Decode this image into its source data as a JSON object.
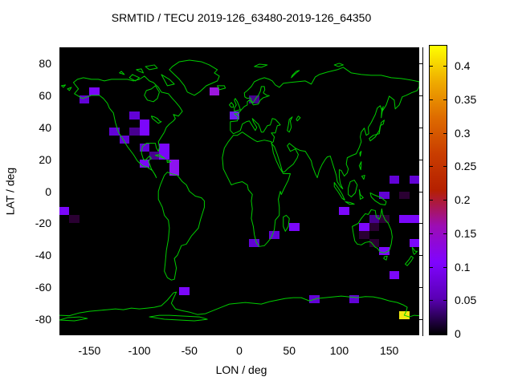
{
  "figure": {
    "title": "SRMTID / TECU 2019-126_63480-2019-126_64350",
    "x_axis": {
      "label": "LON / deg",
      "range": [
        -180,
        180
      ],
      "ticks": [
        -150,
        -100,
        -50,
        0,
        50,
        100,
        150
      ]
    },
    "y_axis": {
      "label": "LAT / deg",
      "range": [
        -90,
        90
      ],
      "ticks": [
        80,
        60,
        40,
        20,
        0,
        -20,
        -40,
        -60,
        -80
      ]
    },
    "map": {
      "background": "#000000",
      "coastline_color": "#00cc00"
    },
    "colorbar": {
      "min": 0,
      "max": 0.43,
      "ticks": [
        {
          "value": 0,
          "label": "0"
        },
        {
          "value": 0.05,
          "label": "0.05"
        },
        {
          "value": 0.1,
          "label": "0.1"
        },
        {
          "value": 0.15,
          "label": "0.15"
        },
        {
          "value": 0.2,
          "label": "0.2"
        },
        {
          "value": 0.25,
          "label": "0.25"
        },
        {
          "value": 0.3,
          "label": "0.3"
        },
        {
          "value": 0.35,
          "label": "0.35"
        },
        {
          "value": 0.4,
          "label": "0.4"
        }
      ],
      "gradient": [
        {
          "pos": 0.0,
          "color": "#000000"
        },
        {
          "pos": 0.125,
          "color": "#5a00b5"
        },
        {
          "pos": 0.25,
          "color": "#8004ff"
        },
        {
          "pos": 0.375,
          "color": "#9c0db5"
        },
        {
          "pos": 0.5,
          "color": "#b52000"
        },
        {
          "pos": 0.625,
          "color": "#c93d00"
        },
        {
          "pos": 0.75,
          "color": "#de6b00"
        },
        {
          "pos": 0.875,
          "color": "#efab00"
        },
        {
          "pos": 1.0,
          "color": "#ffff00"
        }
      ]
    }
  },
  "chart_data": {
    "type": "heatmap",
    "title": "SRMTID / TECU 2019-126_63480-2019-126_64350",
    "xlabel": "LON / deg",
    "ylabel": "LAT / deg",
    "xlim": [
      -180,
      180
    ],
    "ylim": [
      -90,
      90
    ],
    "colorbar_range": [
      0,
      0.43
    ],
    "cell_size": {
      "lon_deg": 10,
      "lat_deg": 5
    },
    "cells": [
      {
        "lon": -150,
        "lat": 60,
        "value": 0.1,
        "color": "#7b07fa"
      },
      {
        "lon": -160,
        "lat": 55,
        "value": 0.07,
        "color": "#6202d6"
      },
      {
        "lon": -30,
        "lat": 60,
        "value": 0.14,
        "color": "#9b17dd"
      },
      {
        "lon": -110,
        "lat": 45,
        "value": 0.07,
        "color": "#6202d6"
      },
      {
        "lon": -100,
        "lat": 40,
        "value": 0.1,
        "color": "#7b07fa"
      },
      {
        "lon": -130,
        "lat": 35,
        "value": 0.07,
        "color": "#6202d6"
      },
      {
        "lon": -110,
        "lat": 35,
        "value": 0.04,
        "color": "#47008f"
      },
      {
        "lon": -100,
        "lat": 35,
        "value": 0.1,
        "color": "#7b07fa"
      },
      {
        "lon": -120,
        "lat": 30,
        "value": 0.07,
        "color": "#6202d6"
      },
      {
        "lon": -100,
        "lat": 25,
        "value": 0.07,
        "color": "#6202d6"
      },
      {
        "lon": -80,
        "lat": 25,
        "value": 0.1,
        "color": "#7b07fa"
      },
      {
        "lon": -90,
        "lat": 20,
        "value": 0.04,
        "color": "#47008f"
      },
      {
        "lon": -80,
        "lat": 20,
        "value": 0.1,
        "color": "#7b07fa"
      },
      {
        "lon": -100,
        "lat": 15,
        "value": 0.1,
        "color": "#7b07fa"
      },
      {
        "lon": -70,
        "lat": 15,
        "value": 0.12,
        "color": "#8d13ef"
      },
      {
        "lon": -70,
        "lat": 10,
        "value": 0.12,
        "color": "#8d13ef"
      },
      {
        "lon": 10,
        "lat": 55,
        "value": 0.04,
        "color": "#47008f"
      },
      {
        "lon": -10,
        "lat": 45,
        "value": 0.1,
        "color": "#6d1df2"
      },
      {
        "lon": 150,
        "lat": 5,
        "value": 0.07,
        "color": "#6202d6"
      },
      {
        "lon": 170,
        "lat": 5,
        "value": 0.07,
        "color": "#6202d6"
      },
      {
        "lon": 140,
        "lat": -5,
        "value": 0.07,
        "color": "#6202d6"
      },
      {
        "lon": 160,
        "lat": -5,
        "value": 0.015,
        "color": "#2a0032"
      },
      {
        "lon": -180,
        "lat": -15,
        "value": 0.1,
        "color": "#7b07fa"
      },
      {
        "lon": -170,
        "lat": -20,
        "value": 0.015,
        "color": "#2a0032"
      },
      {
        "lon": 100,
        "lat": -15,
        "value": 0.1,
        "color": "#7b07fa"
      },
      {
        "lon": 130,
        "lat": -20,
        "value": 0.04,
        "color": "#47008f"
      },
      {
        "lon": 140,
        "lat": -20,
        "value": 0.015,
        "color": "#2a0032"
      },
      {
        "lon": 160,
        "lat": -20,
        "value": 0.1,
        "color": "#7b07fa"
      },
      {
        "lon": 170,
        "lat": -20,
        "value": 0.1,
        "color": "#7b07fa"
      },
      {
        "lon": 120,
        "lat": -25,
        "value": 0.1,
        "color": "#7b07fa"
      },
      {
        "lon": 130,
        "lat": -25,
        "value": 0.015,
        "color": "#2a0032"
      },
      {
        "lon": 50,
        "lat": -25,
        "value": 0.1,
        "color": "#7b07fa"
      },
      {
        "lon": 30,
        "lat": -30,
        "value": 0.07,
        "color": "#6202d6"
      },
      {
        "lon": 120,
        "lat": -30,
        "value": 0.015,
        "color": "#2a0032"
      },
      {
        "lon": 10,
        "lat": -35,
        "value": 0.07,
        "color": "#6202d6"
      },
      {
        "lon": 130,
        "lat": -35,
        "value": 0.015,
        "color": "#2a0032"
      },
      {
        "lon": 140,
        "lat": -40,
        "value": 0.1,
        "color": "#7b07fa"
      },
      {
        "lon": 170,
        "lat": -35,
        "value": 0.1,
        "color": "#7b07fa"
      },
      {
        "lon": 150,
        "lat": -55,
        "value": 0.1,
        "color": "#7b07fa"
      },
      {
        "lon": -60,
        "lat": -65,
        "value": 0.1,
        "color": "#7b07fa"
      },
      {
        "lon": 70,
        "lat": -70,
        "value": 0.07,
        "color": "#6202d6"
      },
      {
        "lon": 110,
        "lat": -70,
        "value": 0.07,
        "color": "#6202d6"
      },
      {
        "lon": 160,
        "lat": -80,
        "value": 0.43,
        "color": "#f2ea12"
      }
    ]
  }
}
